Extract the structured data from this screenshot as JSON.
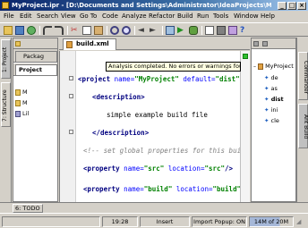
{
  "window": {
    "title": "MyProject.ipr - [D:\\Documents and Settings\\Administrator\\IdeaProjects\\MyProject] - ...\\build.xml"
  },
  "menu": [
    "File",
    "Edit",
    "Search",
    "View",
    "Go To",
    "Code",
    "Analyze",
    "Refactor",
    "Build",
    "Run",
    "Tools",
    "Window",
    "Help"
  ],
  "left_tools": {
    "project": "1: Project",
    "structure": "7: Structure"
  },
  "project_panel": {
    "tab_packages": "Packag",
    "tab_project": "Project",
    "tree": [
      "M",
      "M",
      "Lil"
    ]
  },
  "editor": {
    "tab": "build.xml",
    "tooltip": "Analysis completed. No errors or warnings found.",
    "lines": {
      "l1_tag": "<project ",
      "l1_a1": "name=",
      "l1_v1": "\"MyProject\"",
      "l1_a2": " default=",
      "l1_v2": "\"dist\"",
      "l2": "<description>",
      "l3": "simple example build file",
      "l4": "</description>",
      "l5": "<!-- set global properties for this bui",
      "l6_tag": "<property ",
      "l6_a1": "name=",
      "l6_v1": "\"src\"",
      "l6_a2": " location=",
      "l6_v2": "\"src\"",
      "l6_end": "/>",
      "l7_tag": "<property ",
      "l7_a1": "name=",
      "l7_v1": "\"build\"",
      "l7_a2": " location=",
      "l7_v2": "\"build\""
    }
  },
  "structure_panel": {
    "root": "MyProject",
    "items": [
      "de",
      "as",
      "dist",
      "ini",
      "cle"
    ]
  },
  "right_tools": {
    "commander": "Commander",
    "ant_build": "Ant Build"
  },
  "bottom_tools": {
    "todo": "6: TODO"
  },
  "status": {
    "position": "19:28",
    "mode": "Insert",
    "import_popup": "Import Popup: ON",
    "memory": "14M of 20M"
  }
}
